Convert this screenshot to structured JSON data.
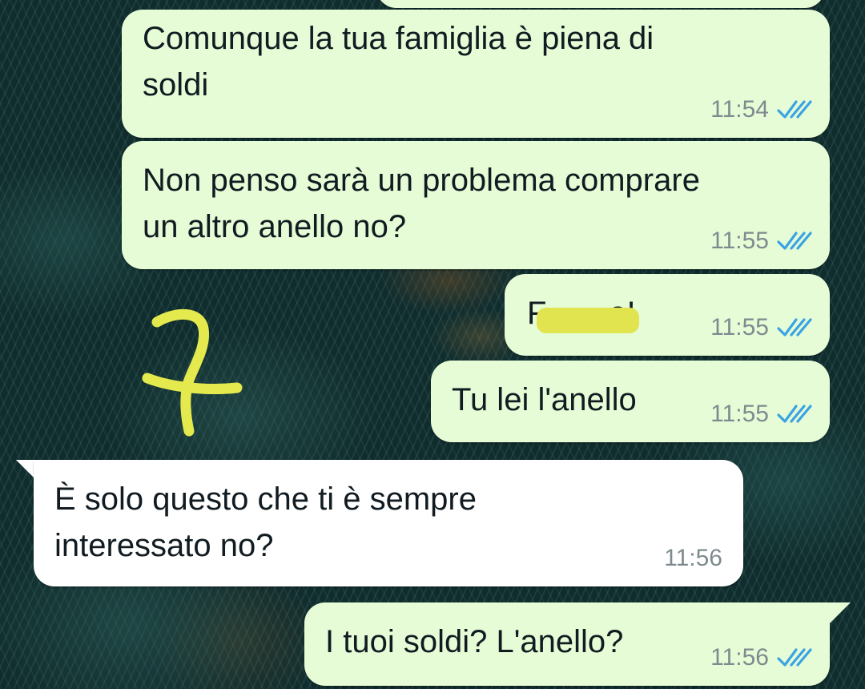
{
  "chat": {
    "messages": [
      {
        "direction": "outgoing",
        "text": "Comunque la tua famiglia è piena di\nsoldi",
        "time": "11:54",
        "status": "read"
      },
      {
        "direction": "outgoing",
        "text": "Non penso sarà un problema comprare\nun altro anello no?",
        "time": "11:55",
        "status": "read"
      },
      {
        "direction": "outgoing",
        "text": "F       o!",
        "time": "11:55",
        "status": "read",
        "redacted": true
      },
      {
        "direction": "outgoing",
        "text": "Tu lei l'anello",
        "time": "11:55",
        "status": "read"
      },
      {
        "direction": "incoming",
        "text": "È solo questo che ti è sempre\ninteressato no?",
        "time": "11:56"
      },
      {
        "direction": "outgoing",
        "text": "I tuoi soldi? L'anello?",
        "time": "11:56",
        "status": "read"
      }
    ]
  },
  "annotation": {
    "text": "7",
    "color": "#e4ea4d"
  },
  "colors": {
    "outgoing_bubble": "#e5fcd6",
    "incoming_bubble": "#ffffff",
    "read_ticks": "#3aa3e3",
    "timestamp": "#7f8a8f",
    "censor_highlight": "#e1e34f"
  },
  "icons": {
    "read_receipt": "double-check-icon"
  }
}
